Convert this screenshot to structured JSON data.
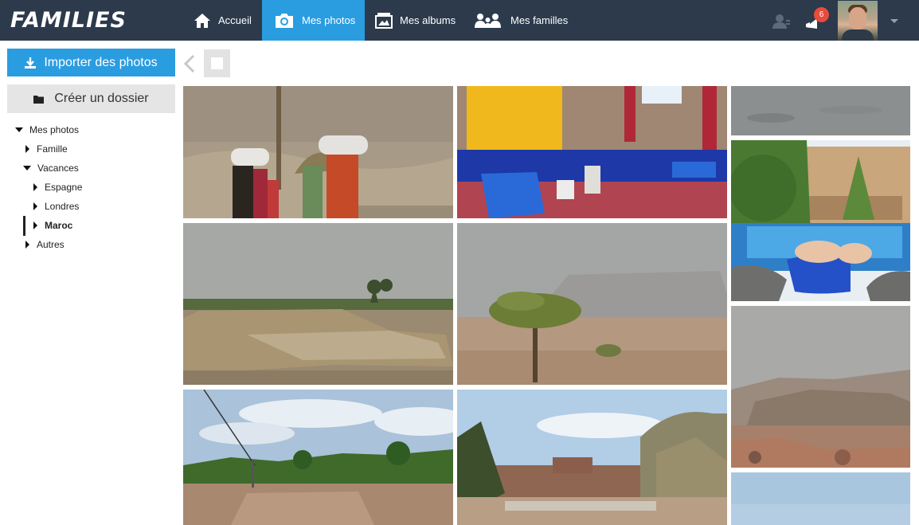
{
  "brand": {
    "logo_text": "FAMILIES"
  },
  "nav": {
    "items": [
      {
        "label": "Accueil",
        "icon": "home-icon"
      },
      {
        "label": "Mes photos",
        "icon": "camera-icon",
        "active": true
      },
      {
        "label": "Mes albums",
        "icon": "album-icon"
      },
      {
        "label": "Mes familles",
        "icon": "people-icon"
      }
    ]
  },
  "header_right": {
    "notification_count": "6",
    "icons": [
      "contacts-icon",
      "bell-icon",
      "avatar",
      "chevron-down-icon"
    ]
  },
  "sidebar": {
    "import_label": "Importer des photos",
    "create_folder_label": "Créer un dossier",
    "tree": [
      {
        "label": "Mes photos",
        "expanded": true,
        "level": 0
      },
      {
        "label": "Famille",
        "expanded": false,
        "level": 1
      },
      {
        "label": "Vacances",
        "expanded": true,
        "level": 1
      },
      {
        "label": "Espagne",
        "expanded": false,
        "level": 2
      },
      {
        "label": "Londres",
        "expanded": false,
        "level": 2
      },
      {
        "label": "Maroc",
        "expanded": false,
        "level": 2,
        "selected": true
      },
      {
        "label": "Autres",
        "expanded": false,
        "level": 1
      }
    ]
  },
  "colors": {
    "topbar": "#2c3a4c",
    "accent": "#2a9de1",
    "badge": "#e74c3c",
    "secondary_button": "#e5e5e5"
  },
  "gallery": {
    "photos": [
      {
        "subject": "women carrying bundles in desert"
      },
      {
        "subject": "blue moroccan lounge interior"
      },
      {
        "subject": "grey sky"
      },
      {
        "subject": "pool with legs"
      },
      {
        "subject": "desert field with palm trees"
      },
      {
        "subject": "acacia tree in desert"
      },
      {
        "subject": "desert mountains"
      },
      {
        "subject": "palm grove with power line"
      },
      {
        "subject": "kasbah with palm trees"
      },
      {
        "subject": "blue sky"
      }
    ]
  }
}
